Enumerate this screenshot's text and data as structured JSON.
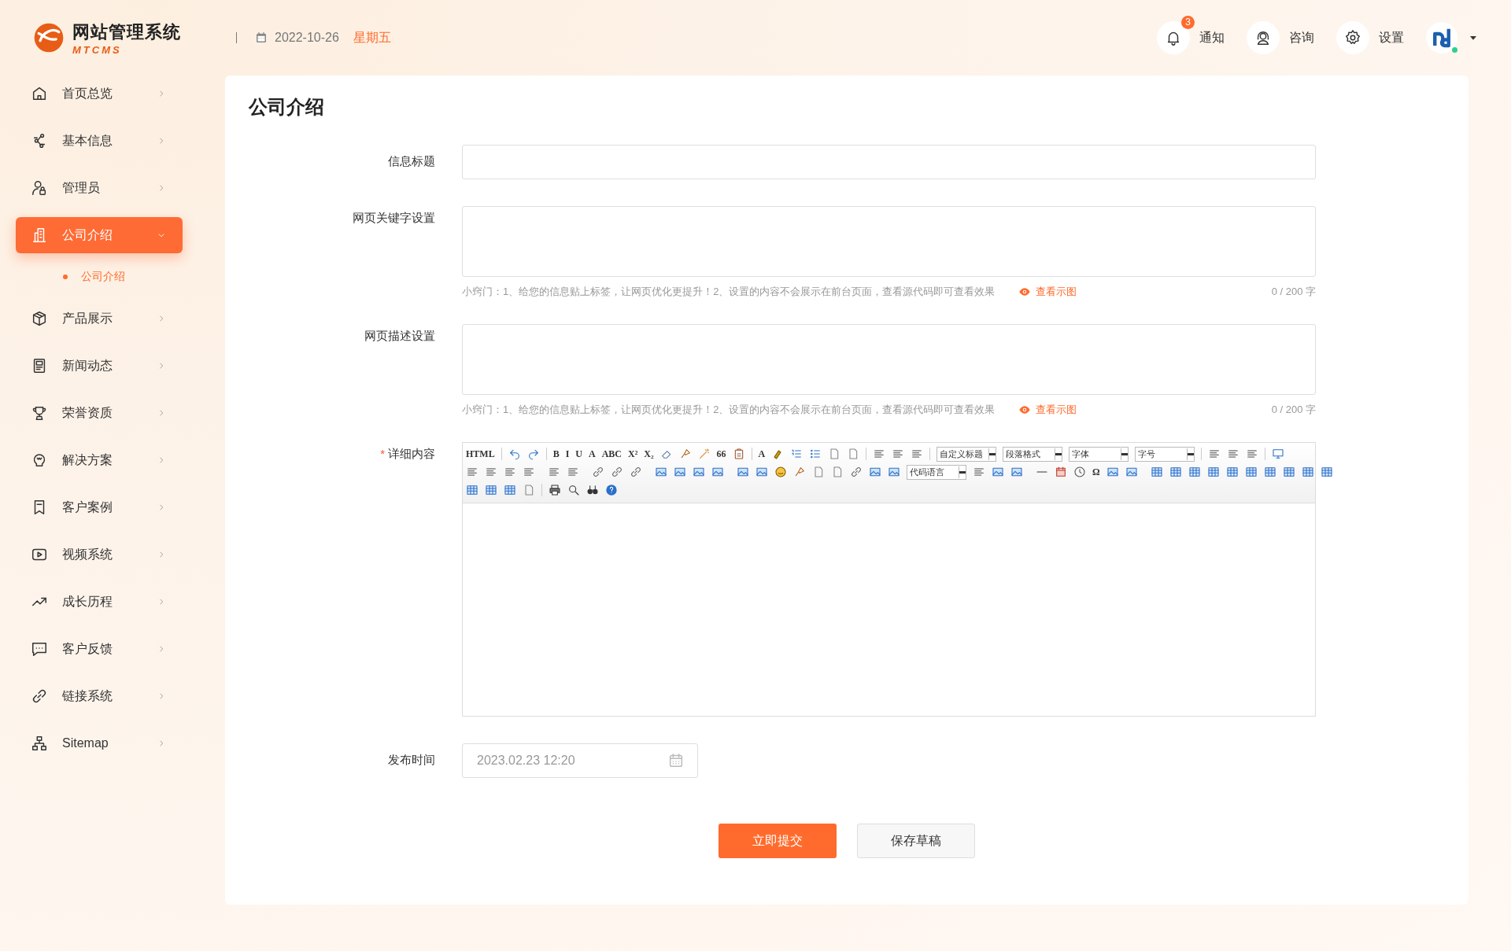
{
  "header": {
    "logo_title": "网站管理系统",
    "logo_subtitle": "MTCMS",
    "date": "2022-10-26",
    "weekday": "星期五",
    "actions": [
      {
        "kind": "bell",
        "label": "通知",
        "badge": "3"
      },
      {
        "kind": "headset",
        "label": "咨询"
      },
      {
        "kind": "gear",
        "label": "设置"
      }
    ],
    "user": {
      "online": true
    }
  },
  "sidebar": {
    "items": [
      {
        "kind": "home",
        "label": "首页总览",
        "expanded": false,
        "selected": false
      },
      {
        "kind": "nodes",
        "label": "基本信息",
        "expanded": false,
        "selected": false
      },
      {
        "kind": "user",
        "label": "管理员",
        "expanded": false,
        "selected": false
      },
      {
        "kind": "building",
        "label": "公司介绍",
        "expanded": true,
        "selected": true,
        "children": [
          {
            "label": "公司介绍",
            "selected": true
          }
        ]
      },
      {
        "kind": "box",
        "label": "产品展示",
        "expanded": false,
        "selected": false
      },
      {
        "kind": "news",
        "label": "新闻动态",
        "expanded": false,
        "selected": false
      },
      {
        "kind": "trophy",
        "label": "荣誉资质",
        "expanded": false,
        "selected": false
      },
      {
        "kind": "bulb",
        "label": "解决方案",
        "expanded": false,
        "selected": false
      },
      {
        "kind": "bookmark",
        "label": "客户案例",
        "expanded": false,
        "selected": false
      },
      {
        "kind": "video",
        "label": "视频系统",
        "expanded": false,
        "selected": false
      },
      {
        "kind": "trend",
        "label": "成长历程",
        "expanded": false,
        "selected": false
      },
      {
        "kind": "chat",
        "label": "客户反馈",
        "expanded": false,
        "selected": false
      },
      {
        "kind": "link",
        "label": "链接系统",
        "expanded": false,
        "selected": false
      },
      {
        "kind": "sitemap",
        "label": "Sitemap",
        "expanded": false,
        "selected": false
      }
    ]
  },
  "page": {
    "title": "公司介绍",
    "fields": [
      {
        "kind": "input",
        "label": "信息标题"
      },
      {
        "kind": "textarea",
        "label": "网页关键字设置",
        "hint": "小窍门：1、给您的信息贴上标签，让网页优化更提升！2、设置的内容不会展示在前台页面，查看源代码即可查看效果",
        "hint_link": "查看示图",
        "counter": "0 / 200 字"
      },
      {
        "kind": "textarea",
        "label": "网页描述设置",
        "hint": "小窍门：1、给您的信息贴上标签，让网页优化更提升！2、设置的内容不会展示在前台页面，查看源代码即可查看效果",
        "hint_link": "查看示图",
        "counter": "0 / 200 字"
      },
      {
        "kind": "editor",
        "label": "详细内容",
        "required_mark": "*",
        "toolbar": [
          [
            {
              "kind": "text",
              "label": "HTML"
            },
            {
              "kind": "sep"
            },
            {
              "kind": "icon"
            },
            {
              "kind": "icon"
            },
            {
              "kind": "sep"
            },
            {
              "kind": "text",
              "label": "B"
            },
            {
              "kind": "text",
              "label": "I"
            },
            {
              "kind": "text",
              "label": "U"
            },
            {
              "kind": "text",
              "label": "A"
            },
            {
              "kind": "text",
              "label": "ABC"
            },
            {
              "kind": "text",
              "label": "X²"
            },
            {
              "kind": "text",
              "label": "X₂"
            },
            {
              "kind": "icon"
            },
            {
              "kind": "icon"
            },
            {
              "kind": "icon"
            },
            {
              "kind": "text",
              "label": "66"
            },
            {
              "kind": "icon"
            },
            {
              "kind": "sep"
            },
            {
              "kind": "text",
              "label": "A"
            },
            {
              "kind": "icon"
            },
            {
              "kind": "icon"
            },
            {
              "kind": "icon"
            },
            {
              "kind": "icon"
            },
            {
              "kind": "icon"
            },
            {
              "kind": "sep"
            },
            {
              "kind": "icon"
            },
            {
              "kind": "icon"
            },
            {
              "kind": "icon"
            },
            {
              "kind": "sep"
            },
            {
              "kind": "select",
              "label": "自定义标题"
            },
            {
              "kind": "select",
              "label": "段落格式"
            },
            {
              "kind": "select",
              "label": "字体"
            },
            {
              "kind": "select",
              "label": "字号"
            },
            {
              "kind": "sep"
            },
            {
              "kind": "icon"
            },
            {
              "kind": "icon"
            },
            {
              "kind": "icon"
            },
            {
              "kind": "sep"
            },
            {
              "kind": "icon"
            }
          ],
          [
            {
              "kind": "icon"
            },
            {
              "kind": "icon"
            },
            {
              "kind": "icon"
            },
            {
              "kind": "icon"
            },
            {
              "kind": "sep"
            },
            {
              "kind": "icon"
            },
            {
              "kind": "icon"
            },
            {
              "kind": "sep"
            },
            {
              "kind": "icon"
            },
            {
              "kind": "icon"
            },
            {
              "kind": "icon"
            },
            {
              "kind": "sep"
            },
            {
              "kind": "icon"
            },
            {
              "kind": "icon"
            },
            {
              "kind": "icon"
            },
            {
              "kind": "icon"
            },
            {
              "kind": "sep"
            },
            {
              "kind": "icon"
            },
            {
              "kind": "icon"
            },
            {
              "kind": "icon"
            },
            {
              "kind": "icon"
            },
            {
              "kind": "icon"
            },
            {
              "kind": "icon"
            },
            {
              "kind": "icon"
            },
            {
              "kind": "icon"
            },
            {
              "kind": "icon"
            },
            {
              "kind": "select",
              "label": "代码语言"
            },
            {
              "kind": "icon"
            },
            {
              "kind": "icon"
            },
            {
              "kind": "icon"
            },
            {
              "kind": "sep"
            },
            {
              "kind": "icon"
            },
            {
              "kind": "icon"
            },
            {
              "kind": "icon"
            },
            {
              "kind": "text",
              "label": "Ω"
            },
            {
              "kind": "icon"
            },
            {
              "kind": "icon"
            },
            {
              "kind": "sep"
            },
            {
              "kind": "icon"
            },
            {
              "kind": "icon"
            },
            {
              "kind": "icon"
            },
            {
              "kind": "icon"
            },
            {
              "kind": "icon"
            },
            {
              "kind": "icon"
            },
            {
              "kind": "icon"
            },
            {
              "kind": "icon"
            },
            {
              "kind": "icon"
            },
            {
              "kind": "icon"
            }
          ],
          [
            {
              "kind": "icon"
            },
            {
              "kind": "icon"
            },
            {
              "kind": "icon"
            },
            {
              "kind": "icon"
            },
            {
              "kind": "sep"
            },
            {
              "kind": "icon"
            },
            {
              "kind": "icon"
            },
            {
              "kind": "icon"
            },
            {
              "kind": "icon"
            }
          ]
        ]
      },
      {
        "kind": "date",
        "label": "发布时间",
        "value": "2023.02.23 12:20"
      }
    ],
    "buttons": [
      {
        "kind": "primary",
        "label": "立即提交"
      },
      {
        "kind": "secondary",
        "label": "保存草稿"
      }
    ]
  }
}
